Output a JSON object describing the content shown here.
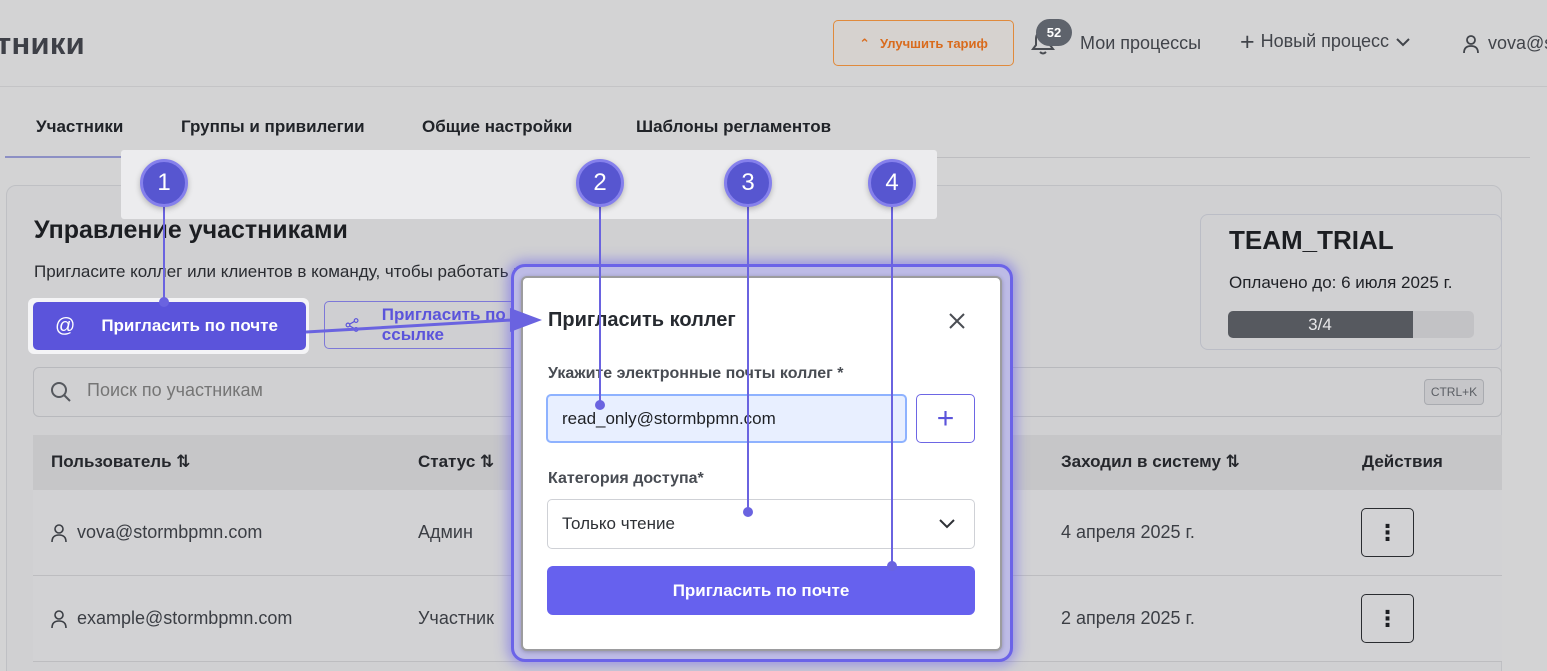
{
  "header": {
    "page_title": "тники",
    "upgrade_label": "Улучшить тариф",
    "notifications_count": "52",
    "my_processes": "Мои процессы",
    "new_process": "Новый процесс",
    "user": "vova@s"
  },
  "tabs": [
    {
      "label": "Участники",
      "active": true
    },
    {
      "label": "Группы и привилегии",
      "active": false
    },
    {
      "label": "Общие настройки",
      "active": false
    },
    {
      "label": "Шаблоны регламентов",
      "active": false
    }
  ],
  "section": {
    "title": "Управление участниками",
    "description": "Пригласите коллег или клиентов в команду, чтобы работать вместе",
    "invite_button": "Пригласить по почте",
    "share_button": "Пригласить по ссылке"
  },
  "plan": {
    "name": "TEAM_TRIAL",
    "paid_until": "Оплачено до: 6 июля 2025 г.",
    "seats_label": "3/4",
    "seats_used_fraction": 0.75
  },
  "search": {
    "placeholder": "Поиск по участникам",
    "shortcut": "CTRL+K"
  },
  "table": {
    "columns": [
      "Пользователь ⇅",
      "Статус ⇅",
      "Заходил в систему ⇅",
      "Действия"
    ],
    "rows": [
      {
        "user": "vova@stormbpmn.com",
        "status": "Админ",
        "last_login": "4 апреля 2025 г."
      },
      {
        "user": "example@stormbpmn.com",
        "status": "Участник",
        "last_login": "2 апреля 2025 г."
      }
    ]
  },
  "modal": {
    "title": "Пригласить коллег",
    "email_label": "Укажите электронные почты коллег *",
    "email_value": "read_only@stormbpmn.com",
    "access_label": "Категория доступа*",
    "access_value": "Только чтение",
    "submit_label": "Пригласить по почте"
  },
  "steps": [
    "1",
    "2",
    "3",
    "4"
  ],
  "colors": {
    "accent": "#5b54db",
    "upgrade": "#d96b1d",
    "step_marker": "#5756d0"
  }
}
